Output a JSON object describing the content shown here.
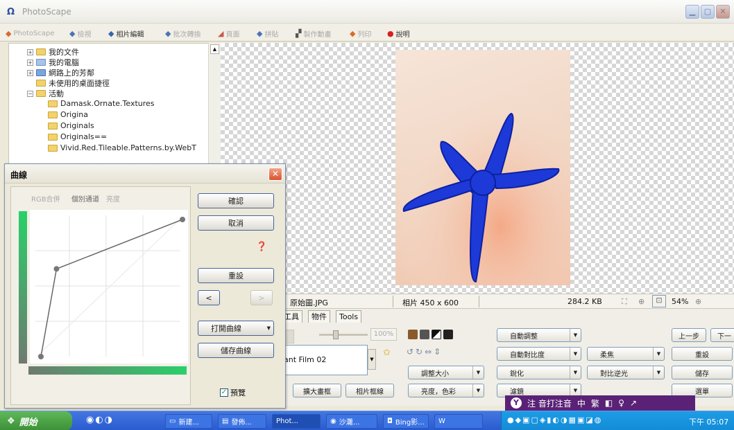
{
  "window": {
    "title": "PhotoScape",
    "logo_glyph": "Ω"
  },
  "tabs": [
    {
      "label": "PhotoScape",
      "icon": "photoscape-icon",
      "active": false
    },
    {
      "label": "檢視",
      "icon": "viewer-icon",
      "active": false
    },
    {
      "label": "相片編輯",
      "icon": "editor-icon",
      "active": true
    },
    {
      "label": "批次轉換",
      "icon": "batch-icon",
      "active": false
    },
    {
      "label": "頁面",
      "icon": "page-icon",
      "active": false
    },
    {
      "label": "拼貼",
      "icon": "combine-icon",
      "active": false
    },
    {
      "label": "製作動畫",
      "icon": "gif-icon",
      "active": false
    },
    {
      "label": "列印",
      "icon": "print-icon",
      "active": false
    },
    {
      "label": "說明",
      "icon": "help-icon",
      "active": false
    }
  ],
  "tree": {
    "items": [
      {
        "label": "我的文件",
        "level": 1,
        "expander": "+"
      },
      {
        "label": "我的電腦",
        "level": 1,
        "expander": "+"
      },
      {
        "label": "網路上的芳鄰",
        "level": 1,
        "expander": "+"
      },
      {
        "label": "未使用的桌面捷徑",
        "level": 1,
        "expander": ""
      },
      {
        "label": "活動",
        "level": 1,
        "expander": "−"
      },
      {
        "label": "Damask.Ornate.Textures",
        "level": 2,
        "expander": ""
      },
      {
        "label": "Origina",
        "level": 2,
        "expander": ""
      },
      {
        "label": "Originals",
        "level": 2,
        "expander": ""
      },
      {
        "label": "Originals==",
        "level": 2,
        "expander": ""
      },
      {
        "label": "Vivid.Red.Tileable.Patterns.by.WebT",
        "level": 2,
        "expander": ""
      }
    ]
  },
  "status": {
    "filename": "原始圖.JPG",
    "dimensions": "相片 450 x 600",
    "filesize": "284.2 KB",
    "zoom": "54%"
  },
  "panel": {
    "subtabs": [
      "工具",
      "物件",
      "Tools"
    ],
    "filter_value": "ant Film 02",
    "brightness_value": "100%",
    "buttons": {
      "enlarge_canvas": "擴大畫框",
      "photo_frame": "相片框線",
      "resize": "調整大小",
      "brightness_color": "亮度，色彩",
      "auto_level": "自動調整",
      "auto_contrast": "自動對比度",
      "sharpen": "銳化",
      "filter": "濾鏡",
      "soften": "柔焦",
      "backlight": "對比逆光",
      "undo": "上一步",
      "redo": "下一",
      "reset": "重設",
      "save": "儲存",
      "menu": "選單"
    }
  },
  "curves_dialog": {
    "title": "曲線",
    "tabs": [
      "RGB合併",
      "個別通道",
      "亮度"
    ],
    "ok": "確認",
    "cancel": "取消",
    "reset": "重設",
    "prev": "<",
    "next": ">",
    "open_curve": "打開曲線",
    "save_curve": "儲存曲線",
    "preview": "預覽",
    "preview_checked": true,
    "curve_points": [
      [
        0,
        0
      ],
      [
        0.11,
        0.64
      ],
      [
        1,
        1
      ]
    ],
    "accent": "#29d06a"
  },
  "ime": {
    "label": "注 音打注音",
    "mode": "中",
    "width": "繁"
  },
  "taskbar": {
    "start": "開始",
    "tasks": [
      "新建...",
      "發佈...",
      "Phot...",
      "沙灘...",
      "Bing影...",
      "W"
    ],
    "clock": "下午 05:07"
  }
}
